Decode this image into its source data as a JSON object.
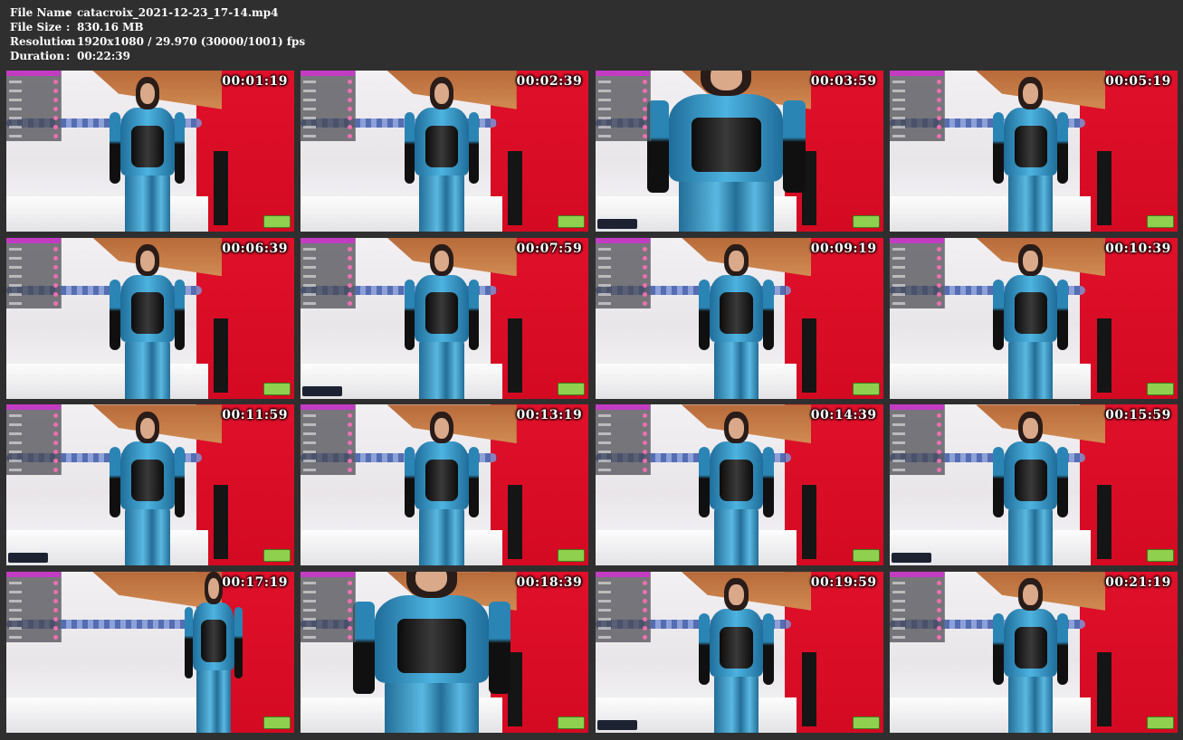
{
  "header": {
    "rows": [
      {
        "key": "File Name",
        "sep": ":",
        "value": "catacroix_2021-12-23_17-14.mp4"
      },
      {
        "key": "File Size",
        "sep": ":",
        "value": "830.16 MB"
      },
      {
        "key": "Resolution",
        "sep": ":",
        "value": "1920x1080 / 29.970 (30000/1001) fps"
      },
      {
        "key": "Duration",
        "sep": ":",
        "value": "00:22:39"
      }
    ]
  },
  "thumbnails": [
    {
      "time": "00:01:19"
    },
    {
      "time": "00:02:39"
    },
    {
      "time": "00:03:59"
    },
    {
      "time": "00:05:19"
    },
    {
      "time": "00:06:39"
    },
    {
      "time": "00:07:59"
    },
    {
      "time": "00:09:19"
    },
    {
      "time": "00:10:39"
    },
    {
      "time": "00:11:59"
    },
    {
      "time": "00:13:19"
    },
    {
      "time": "00:14:39"
    },
    {
      "time": "00:15:59"
    },
    {
      "time": "00:17:19"
    },
    {
      "time": "00:18:39"
    },
    {
      "time": "00:19:59"
    },
    {
      "time": "00:21:19"
    }
  ]
}
